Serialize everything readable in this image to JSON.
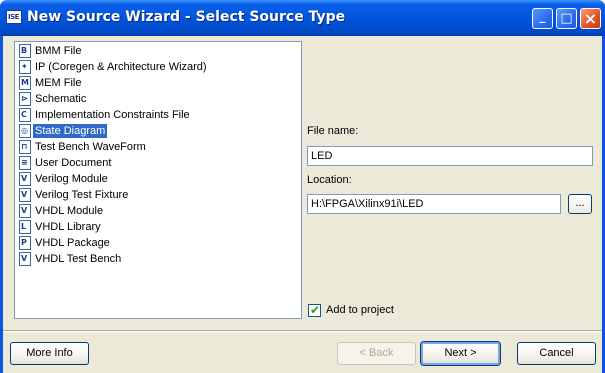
{
  "window": {
    "title": "New Source Wizard - Select Source Type",
    "app_icon_text": "ISE"
  },
  "titlebar_buttons": {
    "minimize": "_",
    "maximize": "□",
    "close": "×"
  },
  "source_types": [
    {
      "label": "BMM File",
      "icon": "bmm-file-icon",
      "glyph": "B"
    },
    {
      "label": "IP (Coregen & Architecture Wizard)",
      "icon": "ip-coregen-icon",
      "glyph": "✦"
    },
    {
      "label": "MEM File",
      "icon": "mem-file-icon",
      "glyph": "M"
    },
    {
      "label": "Schematic",
      "icon": "schematic-icon",
      "glyph": "⊳"
    },
    {
      "label": "Implementation Constraints File",
      "icon": "constraints-file-icon",
      "glyph": "C"
    },
    {
      "label": "State Diagram",
      "icon": "state-diagram-icon",
      "glyph": "◎"
    },
    {
      "label": "Test Bench WaveForm",
      "icon": "waveform-icon",
      "glyph": "⊓"
    },
    {
      "label": "User Document",
      "icon": "user-document-icon",
      "glyph": "≡"
    },
    {
      "label": "Verilog Module",
      "icon": "verilog-module-icon",
      "glyph": "V"
    },
    {
      "label": "Verilog Test Fixture",
      "icon": "verilog-test-fixture-icon",
      "glyph": "V"
    },
    {
      "label": "VHDL Module",
      "icon": "vhdl-module-icon",
      "glyph": "V"
    },
    {
      "label": "VHDL Library",
      "icon": "vhdl-library-icon",
      "glyph": "L"
    },
    {
      "label": "VHDL Package",
      "icon": "vhdl-package-icon",
      "glyph": "P"
    },
    {
      "label": "VHDL Test Bench",
      "icon": "vhdl-test-bench-icon",
      "glyph": "V"
    }
  ],
  "selected_index": 5,
  "file_name": {
    "label": "File name:",
    "value": "LED"
  },
  "location": {
    "label": "Location:",
    "value": "H:\\FPGA\\Xilinx91i\\LED",
    "browse_label": "..."
  },
  "add_to_project": {
    "label": "Add to project",
    "checked": true,
    "check_glyph": "✔"
  },
  "buttons": {
    "more_info": "More Info",
    "back": "< Back",
    "next": "Next >",
    "cancel": "Cancel"
  },
  "colors": {
    "titlebar": "#0255dd",
    "selection": "#316ac5",
    "dialog_bg": "#ece9d8"
  }
}
